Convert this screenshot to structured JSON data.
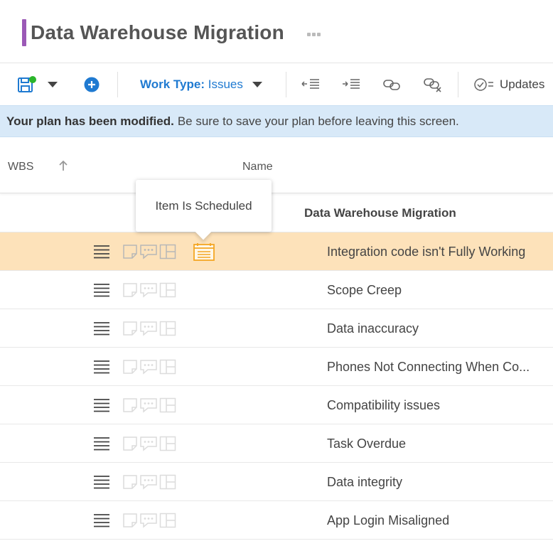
{
  "header": {
    "title": "Data Warehouse Migration",
    "accent_color": "#9b59b6"
  },
  "toolbar": {
    "save_icon": "save-icon",
    "save_status_color": "#2bb52b",
    "add_icon": "add-circle-icon",
    "work_type_label": "Work Type:",
    "work_type_value": "Issues",
    "outdent_icon": "outdent-icon",
    "indent_icon": "indent-icon",
    "link_icon": "link-icon",
    "unlink_icon": "unlink-icon",
    "updates_label": "Updates",
    "accent_color": "#1f7ad1"
  },
  "banner": {
    "bold_text": "Your plan has been modified.",
    "text": "Be sure to save your plan before leaving this screen.",
    "background_color": "#d8e9f8"
  },
  "grid": {
    "columns": {
      "wbs": "WBS",
      "name": "Name"
    },
    "group_name": "Data Warehouse Migration",
    "selected_color": "#fde2ba",
    "rows": [
      {
        "name": "Integration code isn't Fully Working",
        "selected": true,
        "scheduled": true
      },
      {
        "name": "Scope Creep",
        "selected": false,
        "scheduled": false
      },
      {
        "name": "Data inaccuracy",
        "selected": false,
        "scheduled": false
      },
      {
        "name": "Phones Not Connecting When Co...",
        "selected": false,
        "scheduled": false
      },
      {
        "name": "Compatibility issues",
        "selected": false,
        "scheduled": false
      },
      {
        "name": "Task Overdue",
        "selected": false,
        "scheduled": false
      },
      {
        "name": "Data integrity",
        "selected": false,
        "scheduled": false
      },
      {
        "name": "App Login Misaligned",
        "selected": false,
        "scheduled": false
      }
    ]
  },
  "tooltip": {
    "text": "Item Is Scheduled"
  }
}
